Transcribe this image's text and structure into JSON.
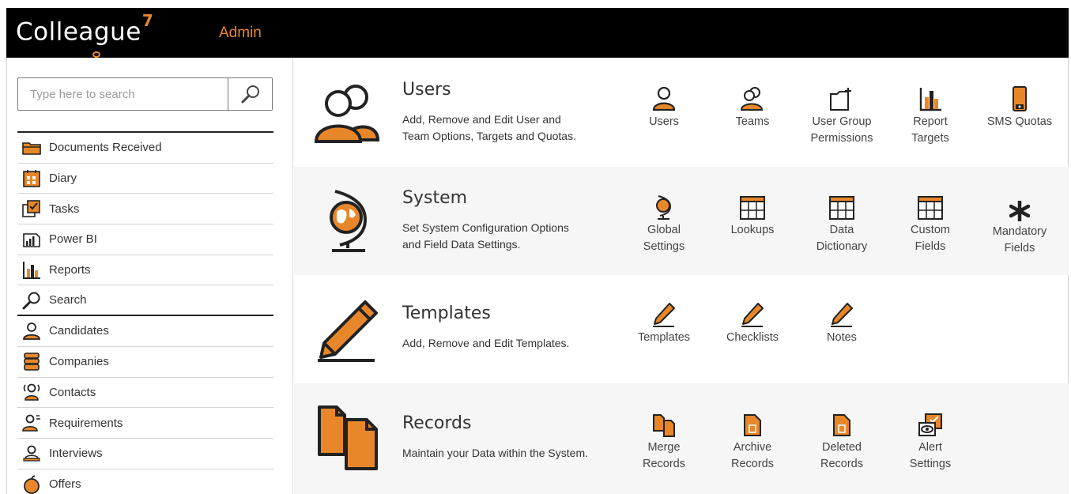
{
  "app": {
    "name": "Colleague",
    "version_mark": "7",
    "section": "Admin"
  },
  "search": {
    "placeholder": "Type here to search"
  },
  "sidebar": {
    "items": [
      {
        "label": "Documents Received",
        "icon": "folder-icon"
      },
      {
        "label": "Diary",
        "icon": "calendar-icon"
      },
      {
        "label": "Tasks",
        "icon": "tasks-icon"
      },
      {
        "label": "Power BI",
        "icon": "powerbi-icon"
      },
      {
        "label": "Reports",
        "icon": "bar-chart-icon"
      },
      {
        "label": "Search",
        "icon": "search-icon"
      },
      {
        "label": "Candidates",
        "icon": "person-icon"
      },
      {
        "label": "Companies",
        "icon": "building-icon"
      },
      {
        "label": "Contacts",
        "icon": "contact-icon"
      },
      {
        "label": "Requirements",
        "icon": "requirement-icon"
      },
      {
        "label": "Interviews",
        "icon": "interview-icon"
      },
      {
        "label": "Offers",
        "icon": "apple-icon"
      }
    ]
  },
  "sections": {
    "users": {
      "title": "Users",
      "desc_line1": "Add, Remove and Edit User and",
      "desc_line2": "Team Options, Targets and Quotas.",
      "tiles": [
        {
          "line1": "Users",
          "line2": ""
        },
        {
          "line1": "Teams",
          "line2": ""
        },
        {
          "line1": "User Group",
          "line2": "Permissions"
        },
        {
          "line1": "Report",
          "line2": "Targets"
        },
        {
          "line1": "SMS Quotas",
          "line2": ""
        }
      ]
    },
    "system": {
      "title": "System",
      "desc_line1": "Set System Configuration Options",
      "desc_line2": "and Field Data Settings.",
      "tiles": [
        {
          "line1": "Global",
          "line2": "Settings"
        },
        {
          "line1": "Lookups",
          "line2": ""
        },
        {
          "line1": "Data",
          "line2": "Dictionary"
        },
        {
          "line1": "Custom",
          "line2": "Fields"
        },
        {
          "line1": "Mandatory",
          "line2": "Fields"
        }
      ]
    },
    "templates": {
      "title": "Templates",
      "desc_line1": "Add, Remove and Edit Templates.",
      "tiles": [
        {
          "line1": "Templates"
        },
        {
          "line1": "Checklists"
        },
        {
          "line1": "Notes"
        }
      ]
    },
    "records": {
      "title": "Records",
      "desc_line1": "Maintain your Data within the System.",
      "tiles": [
        {
          "line1": "Merge",
          "line2": "Records"
        },
        {
          "line1": "Archive",
          "line2": "Records"
        },
        {
          "line1": "Deleted",
          "line2": "Records"
        },
        {
          "line1": "Alert",
          "line2": "Settings"
        }
      ]
    }
  },
  "colors": {
    "accent": "#e8872a",
    "header_bg": "#000000",
    "shaded_row": "#f6f6f6"
  }
}
